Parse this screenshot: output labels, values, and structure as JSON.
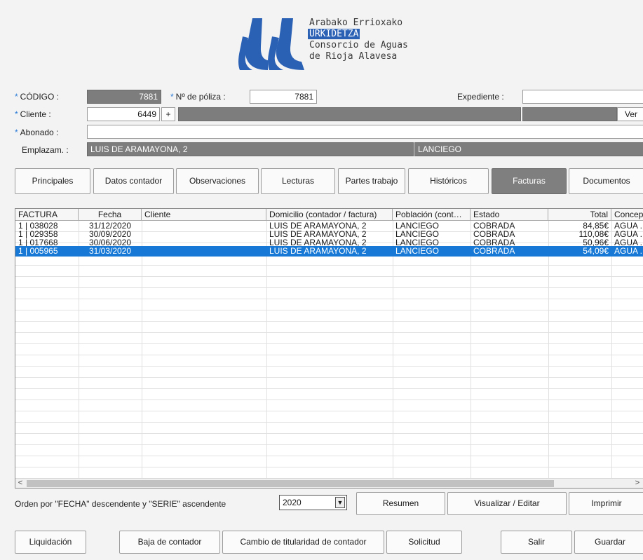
{
  "header": {
    "line1": "Arabako Errioxako",
    "line2": "URKIDETZA",
    "line3": "Consorcio de Aguas",
    "line4": "de Rioja Alavesa",
    "logo_color": "#2a61b5"
  },
  "form": {
    "codigo_label": "CÓDIGO :",
    "codigo_value": "7881",
    "poliza_label": "Nº de póliza :",
    "poliza_value": "7881",
    "expediente_label": "Expediente :",
    "expediente_value": "",
    "cliente_label": "Cliente :",
    "cliente_value": "6449",
    "cliente_plus": "+",
    "cliente_name": "",
    "cliente_extra": "",
    "ver_label": "Ver",
    "abonado_label": "Abonado :",
    "abonado_value": "",
    "emplazam_label": "Emplazam. :",
    "emplazam_address": "LUIS DE ARAMAYONA, 2",
    "emplazam_town": "LANCIEGO",
    "required_mark": "*"
  },
  "tabs": [
    {
      "label": "Principales"
    },
    {
      "label": "Datos contador"
    },
    {
      "label": "Observaciones"
    },
    {
      "label": "Lecturas"
    },
    {
      "label": "Partes trabajo"
    },
    {
      "label": "Históricos"
    },
    {
      "label": "Facturas"
    },
    {
      "label": "Documentos"
    }
  ],
  "table": {
    "columns": [
      "FACTURA",
      "Fecha",
      "Cliente",
      "Domicilio (contador / factura)",
      "Población (cont…",
      "Estado",
      "Total",
      "Concep"
    ],
    "rows": [
      {
        "factura": "1 | 038028",
        "fecha": "31/12/2020",
        "cliente": "",
        "domicilio": "LUIS DE ARAMAYONA, 2",
        "poblacion": "LANCIEGO",
        "estado": "COBRADA",
        "total": "84,85€",
        "concepto": "AGUA ..."
      },
      {
        "factura": "1 | 029358",
        "fecha": "30/09/2020",
        "cliente": "",
        "domicilio": "LUIS DE ARAMAYONA, 2",
        "poblacion": "LANCIEGO",
        "estado": "COBRADA",
        "total": "110,08€",
        "concepto": "AGUA ..."
      },
      {
        "factura": "1 | 017668",
        "fecha": "30/06/2020",
        "cliente": "",
        "domicilio": "LUIS DE ARAMAYONA, 2",
        "poblacion": "LANCIEGO",
        "estado": "COBRADA",
        "total": "50,96€",
        "concepto": "AGUA ..."
      },
      {
        "factura": "1 | 005965",
        "fecha": "31/03/2020",
        "cliente": "",
        "domicilio": "LUIS DE ARAMAYONA, 2",
        "poblacion": "LANCIEGO",
        "estado": "COBRADA",
        "total": "54,09€",
        "concepto": "AGUA ..."
      }
    ],
    "selected_index": 3,
    "scroll_left": "<",
    "scroll_right": ">"
  },
  "footer": {
    "order_text": "Orden por \"FECHA\" descendente y \"SERIE\" ascendente",
    "year": "2020",
    "resumen": "Resumen",
    "visualizar": "Visualizar / Editar",
    "imprimir": "Imprimir"
  },
  "actions": {
    "liquidacion": "Liquidación",
    "baja": "Baja de contador",
    "cambio": "Cambio de titularidad de contador",
    "solicitud": "Solicitud",
    "salir": "Salir",
    "guardar": "Guardar"
  }
}
